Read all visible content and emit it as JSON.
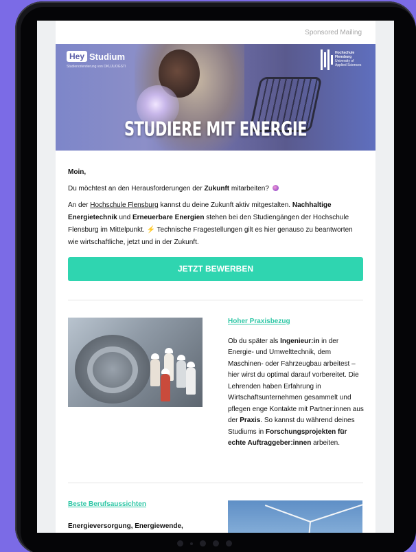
{
  "header": {
    "sponsor": "Sponsored Mailing"
  },
  "hero": {
    "brand_box": "Hey",
    "brand_text": "Studium",
    "brand_sub": "Studienorientierung von DKUJUOGSTI",
    "school_lines": [
      "Hochschule",
      "Flensburg",
      "University of",
      "Applied Sciences"
    ],
    "title": "STUDIERE MIT ENERGIE"
  },
  "intro": {
    "greeting": "Moin,",
    "line1_pre": "Du möchtest an den Herausforderungen der ",
    "line1_bold": "Zukunft",
    "line1_post": " mitarbeiten?",
    "p2_a": "An der ",
    "p2_link": "Hochschule Flensburg",
    "p2_b": " kannst du deine Zukunft aktiv mitgestalten. ",
    "p2_bold1": "Nachhaltige Energietechnik",
    "p2_c": " und ",
    "p2_bold2": "Erneuerbare Energien",
    "p2_d": " stehen bei den Studiengängen der Hochschule Flensburg im Mittelpunkt. ",
    "p2_bolt": "⚡",
    "p2_e": "  Technische Fragestellungen gilt es hier genauso zu beantworten wie wirtschaftliche, jetzt und in der Zukunft."
  },
  "cta": {
    "label": "JETZT BEWERBEN"
  },
  "section1": {
    "title": "Hoher Praxisbezug",
    "t1": "Ob du später als ",
    "b1": "Ingenieur:in",
    "t2": " in der Energie- und Umwelttechnik, dem Maschinen- oder Fahrzeugbau arbeitest – hier wirst du optimal darauf  vorbereitet. Die Lehrenden haben Erfahrung in Wirtschaftsunternehmen gesammelt und pflegen enge Kontakte mit Partner:innen aus der ",
    "b2": "Praxis",
    "t3": ". So kannst du während deines Studiums in ",
    "b3": "Forschungsprojekten für echte Auftraggeber:innen",
    "t4": " arbeiten."
  },
  "section2": {
    "title": "Beste Berufsaussichten",
    "text": "Energieversorgung, Energiewende,"
  },
  "colors": {
    "accent": "#2fd5b0",
    "link": "#2fc7a6",
    "background": "#7b6be6"
  },
  "icons": [
    "crystal-ball-icon",
    "lightning-icon"
  ]
}
